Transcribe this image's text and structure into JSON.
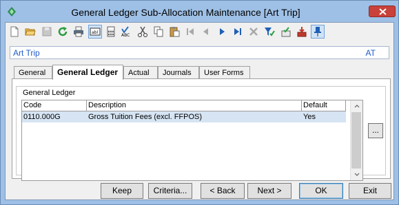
{
  "window": {
    "title": "General Ledger Sub-Allocation Maintenance  [Art Trip]"
  },
  "toolbar": {
    "icons": [
      "new-icon",
      "open-icon",
      "save-icon",
      "refresh-icon",
      "print-icon",
      "text-field-icon",
      "calculator-icon",
      "spellcheck-icon",
      "cut-icon",
      "copy-icon",
      "paste-icon",
      "first-record-icon",
      "previous-record-icon",
      "next-record-icon",
      "last-record-icon",
      "delete-icon",
      "filter-icon",
      "approve-icon",
      "import-icon",
      "pin-icon"
    ]
  },
  "context": {
    "name": "Art Trip",
    "code": "AT"
  },
  "tabs": [
    {
      "label": "General",
      "active": false
    },
    {
      "label": "General Ledger",
      "active": true
    },
    {
      "label": "Actual",
      "active": false
    },
    {
      "label": "Journals",
      "active": false
    },
    {
      "label": "User Forms",
      "active": false
    }
  ],
  "group": {
    "label": "General Ledger"
  },
  "grid": {
    "columns": [
      "Code",
      "Description",
      "Default"
    ],
    "rows": [
      {
        "code": "0110.000G",
        "description": "Gross Tuition Fees (excl. FFPOS)",
        "default": "Yes"
      }
    ]
  },
  "ellipsis_label": "...",
  "buttons": {
    "keep": "Keep",
    "criteria": "Criteria...",
    "back": "< Back",
    "next": "Next >",
    "ok": "OK",
    "exit": "Exit"
  },
  "colors": {
    "context_text": "#1f5bc8",
    "title_bar": "#9ec0e6",
    "close_button": "#c8413a",
    "selected_row": "#d6e4f3"
  }
}
